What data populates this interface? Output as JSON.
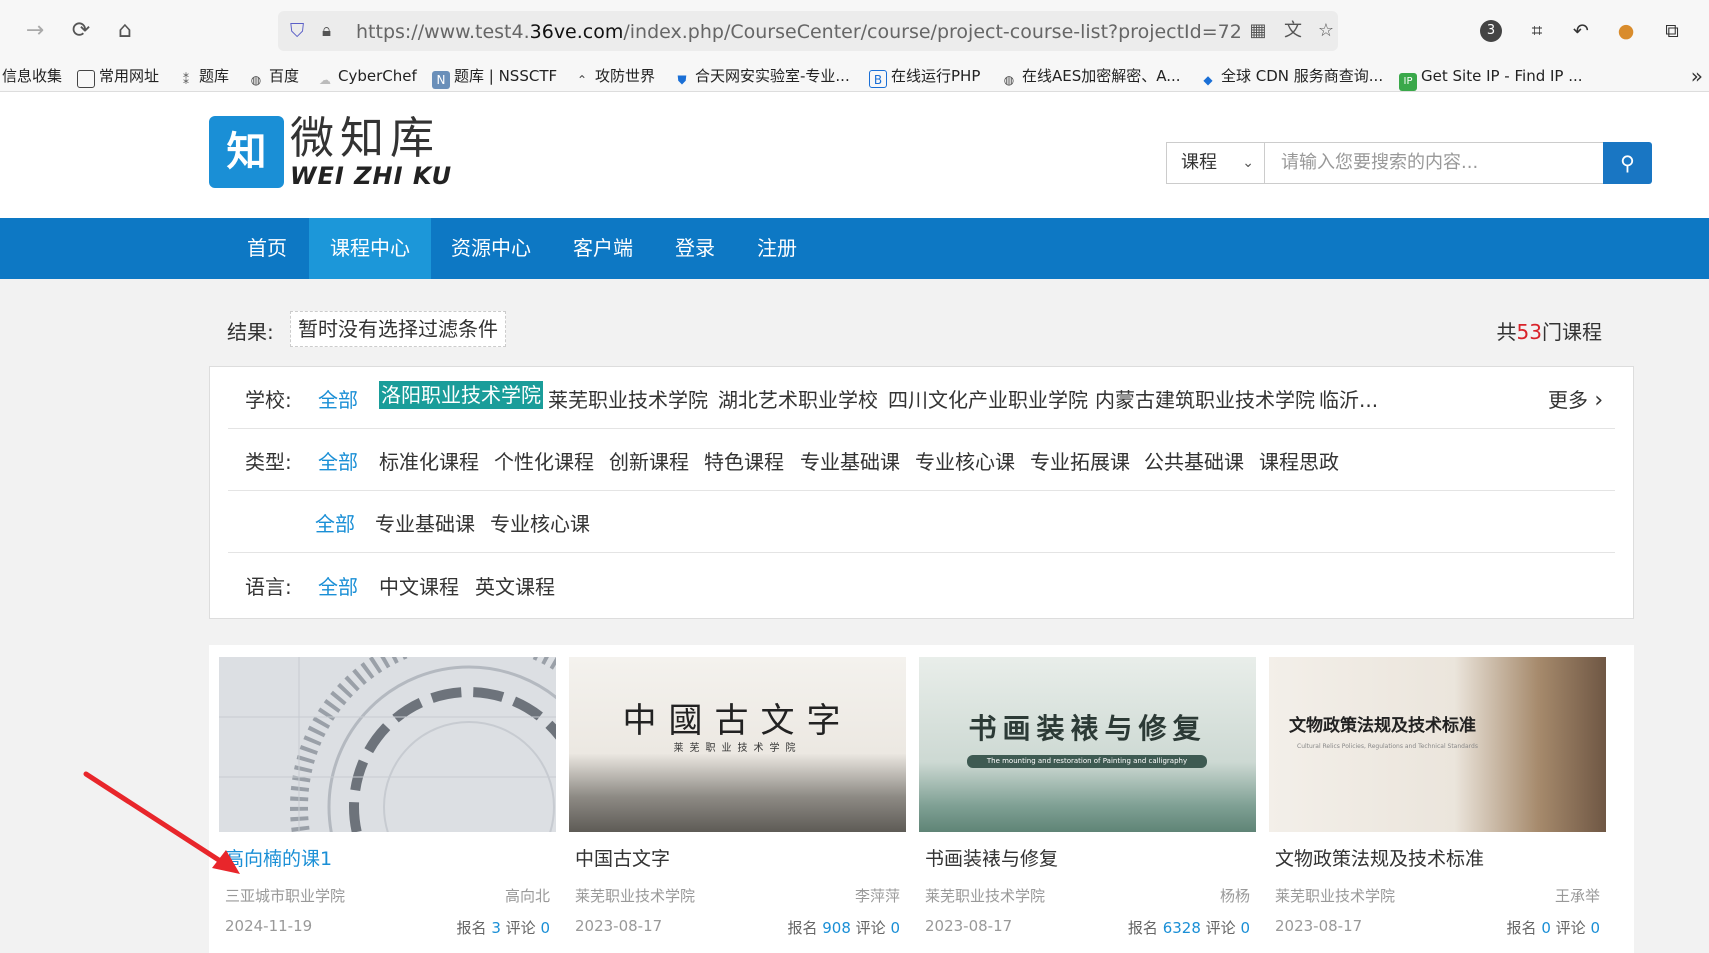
{
  "browser": {
    "url_prefix": "https://www.test4.",
    "url_domain": "36ve.com",
    "url_path": "/index.php/CourseCenter/course/project-course-list?projectId=72",
    "extension_badge": "3"
  },
  "bookmarks": [
    {
      "label": "信息收集",
      "icon": ""
    },
    {
      "label": "常用网址",
      "icon": "folder-icon"
    },
    {
      "label": "题库",
      "icon": "tag-icon"
    },
    {
      "label": "百度",
      "icon": "globe-icon"
    },
    {
      "label": "CyberChef",
      "icon": "chef-icon"
    },
    {
      "label": "题库 | NSSCTF",
      "icon": "nss-icon"
    },
    {
      "label": "攻防世界",
      "icon": "adworld-icon"
    },
    {
      "label": "合天网安实验室-专业...",
      "icon": "shield-icon"
    },
    {
      "label": "在线运行PHP",
      "icon": "b-icon"
    },
    {
      "label": "在线AES加密解密、A...",
      "icon": "globe-icon"
    },
    {
      "label": "全球 CDN 服务商查询...",
      "icon": "cdn-icon"
    },
    {
      "label": "Get Site IP - Find IP ...",
      "icon": "ip-icon"
    }
  ],
  "site": {
    "logo_cn": "微知库",
    "logo_en": "WEI ZHI KU",
    "logo_mark": "知",
    "search_type": "课程",
    "search_placeholder": "请输入您要搜索的内容..."
  },
  "nav": [
    "首页",
    "课程中心",
    "资源中心",
    "客户端",
    "登录",
    "注册"
  ],
  "nav_active": "课程中心",
  "result": {
    "label": "结果:",
    "tag": "暂时没有选择过滤条件",
    "total_prefix": "共",
    "total_count": "53",
    "total_suffix": "门课程"
  },
  "filters": {
    "school": {
      "label": "学校:",
      "all": "全部",
      "options": [
        "洛阳职业技术学院",
        "莱芜职业技术学院",
        "湖北艺术职业学校",
        "四川文化产业职业学院",
        "内蒙古建筑职业技术学院",
        "临沂..."
      ],
      "selected": "洛阳职业技术学院",
      "more": "更多"
    },
    "type": {
      "label": "类型:",
      "all": "全部",
      "options": [
        "标准化课程",
        "个性化课程",
        "创新课程",
        "特色课程",
        "专业基础课",
        "专业核心课",
        "专业拓展课",
        "公共基础课",
        "课程思政"
      ]
    },
    "subtype": {
      "all": "全部",
      "options": [
        "专业基础课",
        "专业核心课"
      ]
    },
    "language": {
      "label": "语言:",
      "all": "全部",
      "options": [
        "中文课程",
        "英文课程"
      ]
    }
  },
  "courses": [
    {
      "title": "高向楠的课1",
      "school": "三亚城市职业学院",
      "teacher": "高向北",
      "date": "2024-11-19",
      "enroll_label": "报名",
      "enroll": "3",
      "comment_label": "评论",
      "comments": "0"
    },
    {
      "title": "中国古文字",
      "school": "莱芜职业技术学院",
      "teacher": "李萍萍",
      "date": "2023-08-17",
      "enroll_label": "报名",
      "enroll": "908",
      "comment_label": "评论",
      "comments": "0",
      "thumb_title": "中國古文字",
      "thumb_sub": "莱芜职业技术学院"
    },
    {
      "title": "书画装裱与修复",
      "school": "莱芜职业技术学院",
      "teacher": "杨杨",
      "date": "2023-08-17",
      "enroll_label": "报名",
      "enroll": "6328",
      "comment_label": "评论",
      "comments": "0",
      "thumb_title": "书画装裱与修复",
      "thumb_sub": "The mounting and restoration of Painting and calligraphy"
    },
    {
      "title": "文物政策法规及技术标准",
      "school": "莱芜职业技术学院",
      "teacher": "王承举",
      "date": "2023-08-17",
      "enroll_label": "报名",
      "enroll": "0",
      "comment_label": "评论",
      "comments": "0",
      "thumb_title": "文物政策法规及技术标准",
      "thumb_sub": "Cultural Relics Policies, Regulations and Technical Standards"
    }
  ],
  "colors": {
    "nav_bg": "#0d78c4",
    "nav_active": "#1c97d9",
    "link_blue": "#1a8fd6",
    "selected_bg": "#1a9d9a",
    "count_red": "#d9232a",
    "annotation_arrow": "#e8262b"
  }
}
